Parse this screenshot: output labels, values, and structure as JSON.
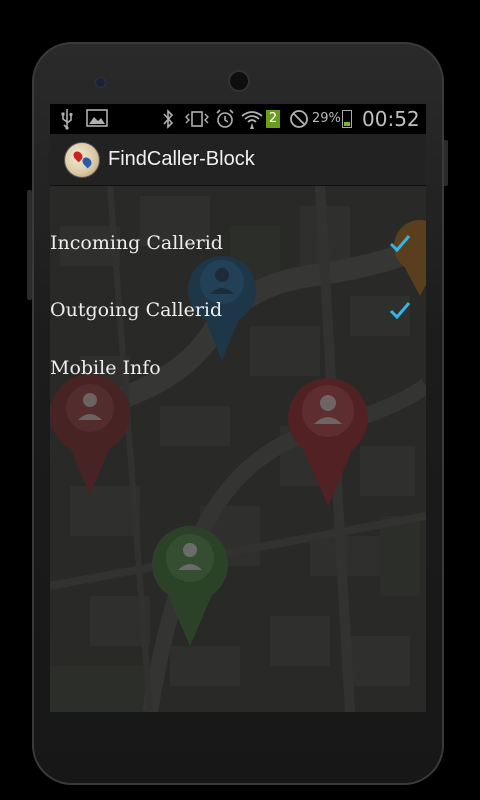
{
  "status_bar": {
    "icons": [
      "usb-icon",
      "image-icon",
      "bluetooth-icon",
      "vibrate-icon",
      "alarm-icon",
      "wifi-icon",
      "sim-icon",
      "no-signal-icon",
      "battery-icon"
    ],
    "sim_badge": "2",
    "battery_percent": "29%",
    "battery_level": 0.29,
    "clock": "00:52"
  },
  "action_bar": {
    "title": "FindCaller-Block"
  },
  "preferences": [
    {
      "label": "Incoming Callerid",
      "checked": true
    },
    {
      "label": "Outgoing Callerid",
      "checked": true
    },
    {
      "label": "Mobile Info",
      "checked": false
    }
  ],
  "colors": {
    "check_accent": "#33b5e5",
    "status_bar_bg": "#000000",
    "pin_blue": "#1c5f8c",
    "pin_red": "#a3262b",
    "pin_green": "#3f7d38"
  }
}
